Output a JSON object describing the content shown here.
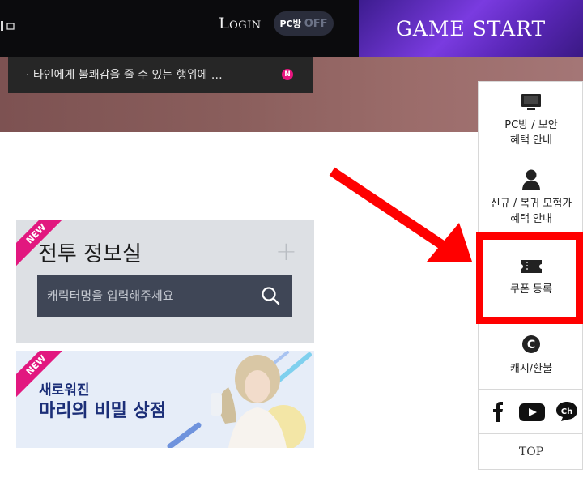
{
  "topbar": {
    "login_label": "Login",
    "pcbang_label": "PC방",
    "pcbang_status": "OFF",
    "game_start_label": "GAME START"
  },
  "notice": {
    "text": "· 타인에게 불쾌감을 줄 수 있는 행위에 …",
    "badge": "N"
  },
  "battle_info": {
    "badge": "NEW",
    "title": "전투 정보실",
    "search_placeholder": "캐릭터명을 입력해주세요"
  },
  "mari_shop": {
    "badge": "NEW",
    "line1": "새로워진",
    "line2": "마리의 비밀 상점"
  },
  "quick_menu": {
    "pc_security_line1": "PC방 / 보안",
    "pc_security_line2": "혜택 안내",
    "newcomer_line1": "신규 / 복귀 모험가",
    "newcomer_line2": "혜택 안내",
    "coupon": "쿠폰 등록",
    "cash": "캐시/환불",
    "top": "TOP"
  },
  "colors": {
    "accent_pink": "#e2187f",
    "highlight_red": "#ff0000",
    "game_start_purple": "#6a31cc"
  }
}
